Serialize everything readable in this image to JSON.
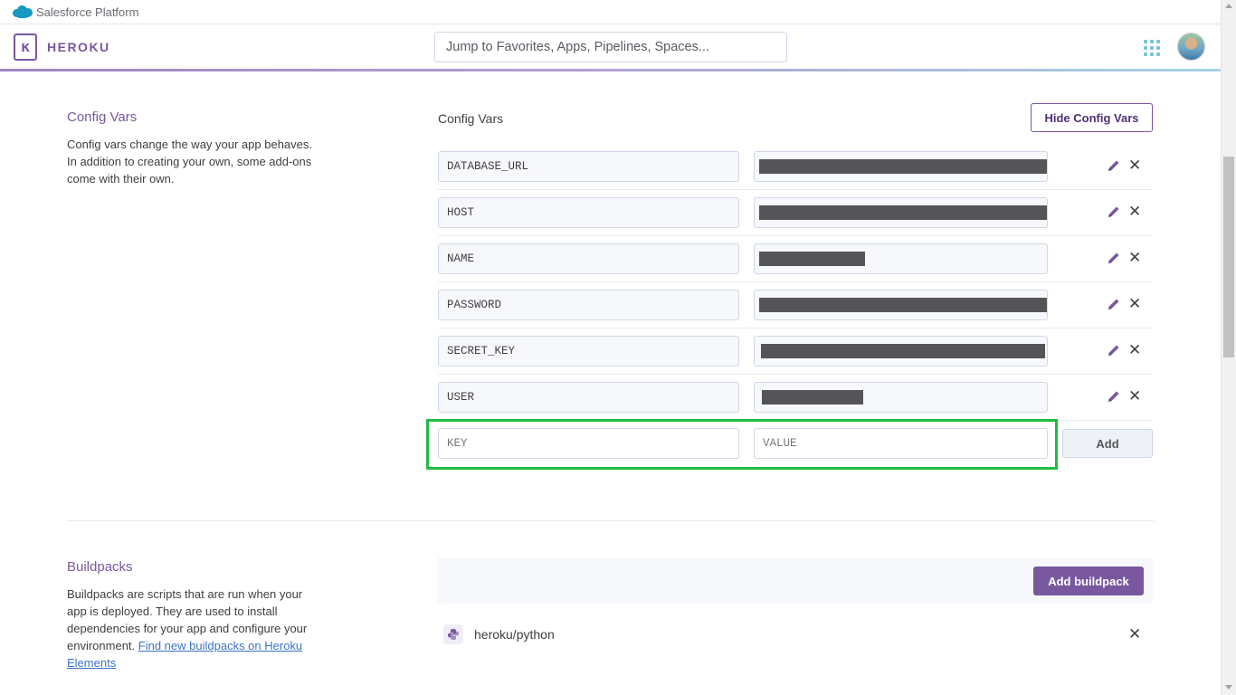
{
  "topbar": {
    "platform_label": "Salesforce Platform"
  },
  "header": {
    "brand": "HEROKU",
    "logo_glyph": "ĸ",
    "search_placeholder": "Jump to Favorites, Apps, Pipelines, Spaces..."
  },
  "config_vars": {
    "title": "Config Vars",
    "description": "Config vars change the way your app behaves. In addition to creating your own, some add-ons come with their own.",
    "heading": "Config Vars",
    "hide_button": "Hide Config Vars",
    "vars": [
      {
        "key": "DATABASE_URL",
        "value_redacted": true
      },
      {
        "key": "HOST",
        "value_redacted": true
      },
      {
        "key": "NAME",
        "value_redacted": true
      },
      {
        "key": "PASSWORD",
        "value_redacted": true
      },
      {
        "key": "SECRET_KEY",
        "value_redacted": true
      },
      {
        "key": "USER",
        "value_redacted": true
      }
    ],
    "new_var": {
      "key_placeholder": "KEY",
      "value_placeholder": "VALUE",
      "add_button": "Add"
    },
    "delete_glyph": "✕"
  },
  "buildpacks": {
    "title": "Buildpacks",
    "description": "Buildpacks are scripts that are run when your app is deployed. They are used to install dependencies for your app and configure your environment.",
    "link_text": "Find new buildpacks on Heroku Elements",
    "add_button": "Add buildpack",
    "items": [
      {
        "name": "heroku/python",
        "icon": "python-icon"
      }
    ]
  },
  "colors": {
    "brand_purple": "#79589f",
    "highlight_green": "#22bb44",
    "redaction": "#555558"
  }
}
